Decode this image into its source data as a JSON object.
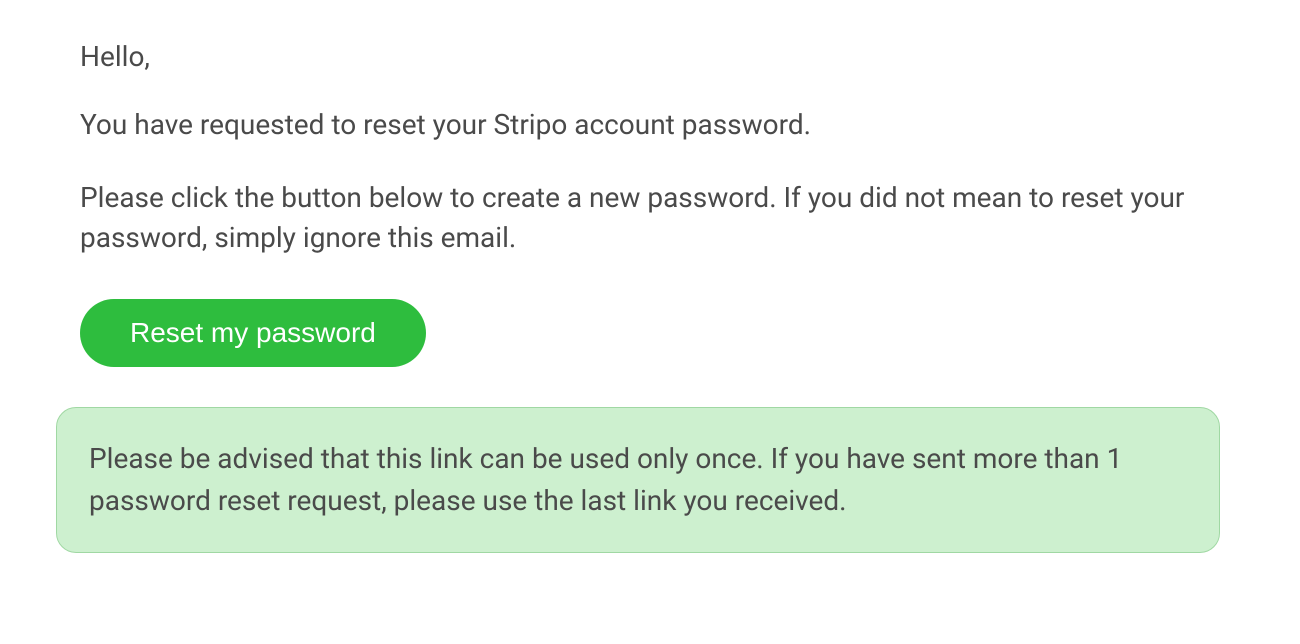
{
  "email": {
    "greeting": "Hello,",
    "line1": "You have requested to reset your Stripo account password.",
    "line2": "Please click the button below to create a new password. If you did not mean to reset your password, simply ignore this email.",
    "button_label": "Reset my password",
    "notice": "Please be advised that this link can be used only once. If you have sent more than 1 password reset request, please use the last link you received."
  }
}
